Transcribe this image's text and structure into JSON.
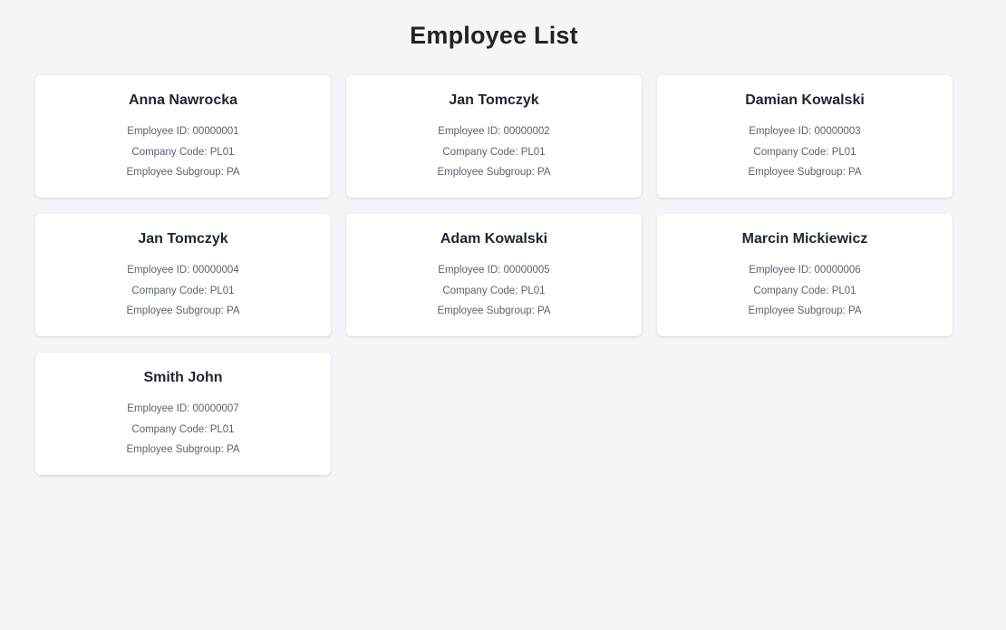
{
  "page": {
    "title": "Employee List"
  },
  "labels": {
    "employee_id": "Employee ID:",
    "company_code": "Company Code:",
    "employee_subgroup": "Employee Subgroup:"
  },
  "employees": [
    {
      "name": "Anna Nawrocka",
      "employee_id": "00000001",
      "company_code": "PL01",
      "employee_subgroup": "PA"
    },
    {
      "name": "Jan Tomczyk",
      "employee_id": "00000002",
      "company_code": "PL01",
      "employee_subgroup": "PA"
    },
    {
      "name": "Damian Kowalski",
      "employee_id": "00000003",
      "company_code": "PL01",
      "employee_subgroup": "PA"
    },
    {
      "name": "Jan Tomczyk",
      "employee_id": "00000004",
      "company_code": "PL01",
      "employee_subgroup": "PA"
    },
    {
      "name": "Adam Kowalski",
      "employee_id": "00000005",
      "company_code": "PL01",
      "employee_subgroup": "PA"
    },
    {
      "name": "Marcin Mickiewicz",
      "employee_id": "00000006",
      "company_code": "PL01",
      "employee_subgroup": "PA"
    },
    {
      "name": "Smith John",
      "employee_id": "00000007",
      "company_code": "PL01",
      "employee_subgroup": "PA"
    }
  ],
  "colors": {
    "background": "#f4f5f9",
    "card": "#ffffff",
    "title_text": "#222222",
    "name_text": "#1e2433",
    "detail_text": "#5b6270"
  }
}
